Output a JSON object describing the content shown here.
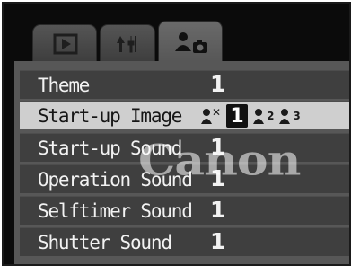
{
  "tabs": [
    {
      "icon": "play-icon",
      "active": false
    },
    {
      "icon": "setup-icon",
      "active": false
    },
    {
      "icon": "my-camera-icon",
      "active": true
    }
  ],
  "menu": [
    {
      "label": "Theme",
      "value": "1"
    },
    {
      "label": "Start-up Image",
      "options": [
        "✕",
        "1",
        "2",
        "3"
      ],
      "selected": "1"
    },
    {
      "label": "Start-up Sound",
      "value": "1"
    },
    {
      "label": "Operation Sound",
      "value": "1"
    },
    {
      "label": "Selftimer Sound",
      "value": "1"
    },
    {
      "label": "Shutter Sound",
      "value": "1"
    }
  ],
  "watermark": "Canon",
  "colors": {
    "highlight": "#cfcfcf",
    "row": "#3f3f3f",
    "panel": "#575757"
  }
}
